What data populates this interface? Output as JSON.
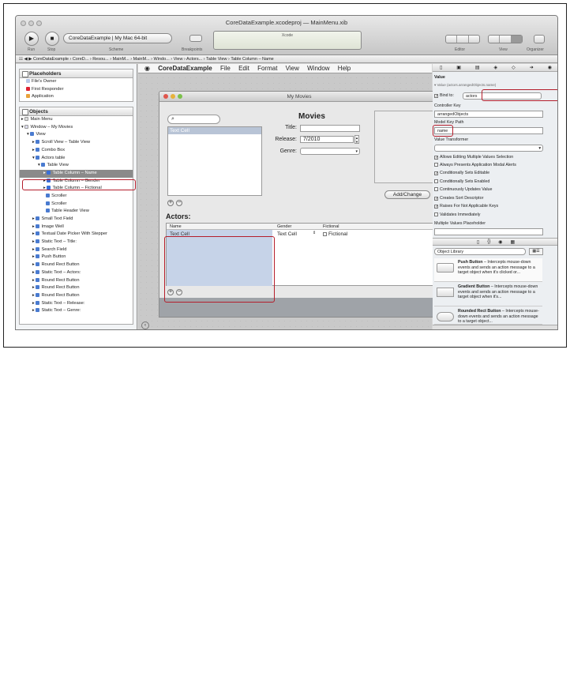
{
  "window": {
    "title": "CoreDataExample.xcodeproj — MainMenu.xib",
    "scheme": "CoreDataExample  |  My Mac 64-bit",
    "lcd_text": "Xcode",
    "toolbar_labels": {
      "run": "Run",
      "stop": "Stop",
      "scheme": "Scheme",
      "breakpoints": "Breakpoints",
      "editor": "Editor",
      "view": "View",
      "organizer": "Organizer"
    }
  },
  "jumpbar": {
    "crumbs": [
      "CoreDataExample",
      "CoreD...",
      "Resou...",
      "MainM...",
      "MainM...",
      "Windo...",
      "View",
      "Actors...",
      "Table View",
      "Table Column – Name"
    ]
  },
  "navigator": {
    "placeholders_header": "Placeholders",
    "placeholders": [
      "File's Owner",
      "First Responder",
      "Application"
    ],
    "objects_header": "Objects",
    "objects": [
      "Main Menu",
      "Window – My Movies",
      "View",
      "Scroll View – Table View",
      "Combo Box",
      "Actors table",
      "Table View",
      "Table Column – Name",
      "Table Column – Gender",
      "Table Column – Fictional",
      "Scroller",
      "Scroller",
      "Table Header View",
      "Small Text Field",
      "Image Well",
      "Textual Date Picker With Stepper",
      "Static Text – Title:",
      "Search Field",
      "Push Button",
      "Round Rect Button",
      "Static Text – Actors:",
      "Round Rect Button",
      "Round Rect Button",
      "Round Rect Button",
      "Static Text – Release:",
      "Static Text – Genre:"
    ]
  },
  "menubar": {
    "app": "CoreDataExample",
    "items": [
      "File",
      "Edit",
      "Format",
      "View",
      "Window",
      "Help"
    ]
  },
  "my_movies": {
    "title": "My Movies",
    "heading": "Movies",
    "title_label": "Title:",
    "release_label": "Release:",
    "release_value": "7/2010",
    "genre_label": "Genre:",
    "list_cell": "Text Cell",
    "add_change": "Add/Change",
    "actors_label": "Actors:",
    "columns": [
      "Name",
      "Gender",
      "Fictional"
    ],
    "row_name": "Text Cell",
    "row_gender": "Text Cell",
    "row_fictional": "Fictional"
  },
  "inspector": {
    "section": "Value",
    "value_subheader": "Value (actors.arrangedObjects.name)",
    "bind_to_label": "Bind to:",
    "bind_to_value": "actors",
    "controller_key_label": "Controller Key",
    "controller_key_value": "arrangedObjects",
    "model_key_path_label": "Model Key Path",
    "model_key_path_value": "name",
    "value_transformer_label": "Value Transformer",
    "options": [
      {
        "label": "Allows Editing Multiple Values Selection",
        "checked": true
      },
      {
        "label": "Always Presents Application Modal Alerts",
        "checked": false
      },
      {
        "label": "Conditionally Sets Editable",
        "checked": true
      },
      {
        "label": "Conditionally Sets Enabled",
        "checked": false
      },
      {
        "label": "Continuously Updates Value",
        "checked": false
      },
      {
        "label": "Creates Sort Descriptor",
        "checked": true
      },
      {
        "label": "Raises For Not Applicable Keys",
        "checked": true
      },
      {
        "label": "Validates Immediately",
        "checked": false
      }
    ],
    "multiple_values_placeholder": "Multiple Values Placeholder",
    "library_select": "Object Library",
    "library": [
      {
        "name": "Push Button",
        "desc": "Intercepts mouse-down events and sends an action message to a target object when it's clicked or..."
      },
      {
        "name": "Gradient Button",
        "desc": "Intercepts mouse-down events and sends an action message to a target object when it's..."
      },
      {
        "name": "Rounded Rect Button",
        "desc": "Intercepts mouse-down events and sends an action message to a target object..."
      }
    ]
  },
  "colors": {
    "highlight": "#b41e2c",
    "selection": "#8a8a8a",
    "table_cell": "#c6d3e8"
  }
}
